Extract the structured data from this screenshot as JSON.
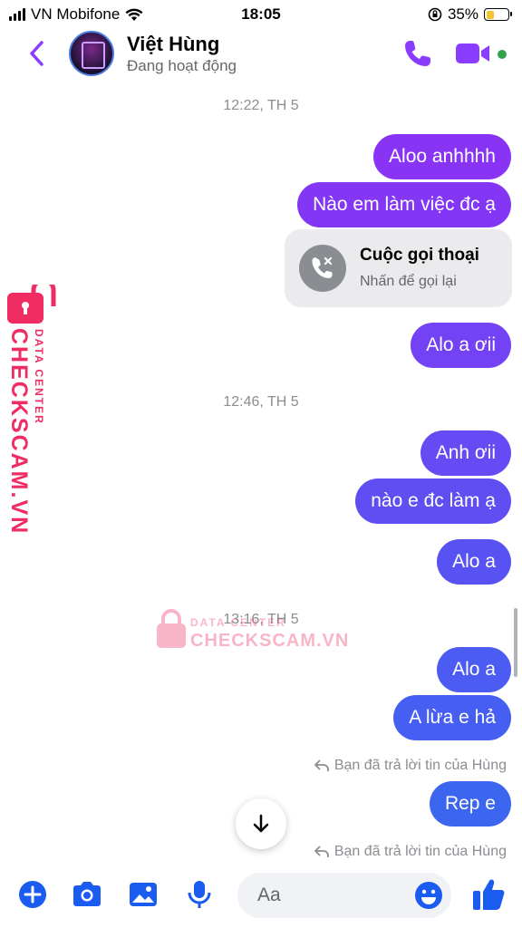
{
  "status_bar": {
    "carrier": "VN Mobifone",
    "time": "18:05",
    "battery_percent": "35%",
    "battery_level": 0.35
  },
  "header": {
    "contact_name": "Việt Hùng",
    "contact_status": "Đang hoạt động"
  },
  "colors": {
    "accent": "#8b3dff",
    "bubble_top": "#8a33f5",
    "bubble_bottom": "#3a66f0",
    "online": "#31a24c",
    "watermark": "#ef2d63"
  },
  "conversation": {
    "timestamps": [
      "12:22, TH 5",
      "12:46, TH 5",
      "13:16, TH 5"
    ],
    "messages": [
      "Aloo anhhhh",
      "Nào em làm việc đc ạ",
      "Alo a ơii",
      "Anh ơii",
      "nào e đc làm ạ",
      "Alo a",
      "Alo a",
      "A lừa e hả",
      "Rep e"
    ],
    "call_card": {
      "title": "Cuộc gọi thoại",
      "subtitle": "Nhấn để gọi lại"
    },
    "reply_notes": [
      "Bạn đã trả lời tin của Hùng",
      "Bạn đã trả lời tin của Hùng"
    ]
  },
  "watermark": {
    "brand": "CHECKSCAM.VN",
    "tagline": "DATA CENTER"
  },
  "composer": {
    "placeholder": "Aa"
  }
}
